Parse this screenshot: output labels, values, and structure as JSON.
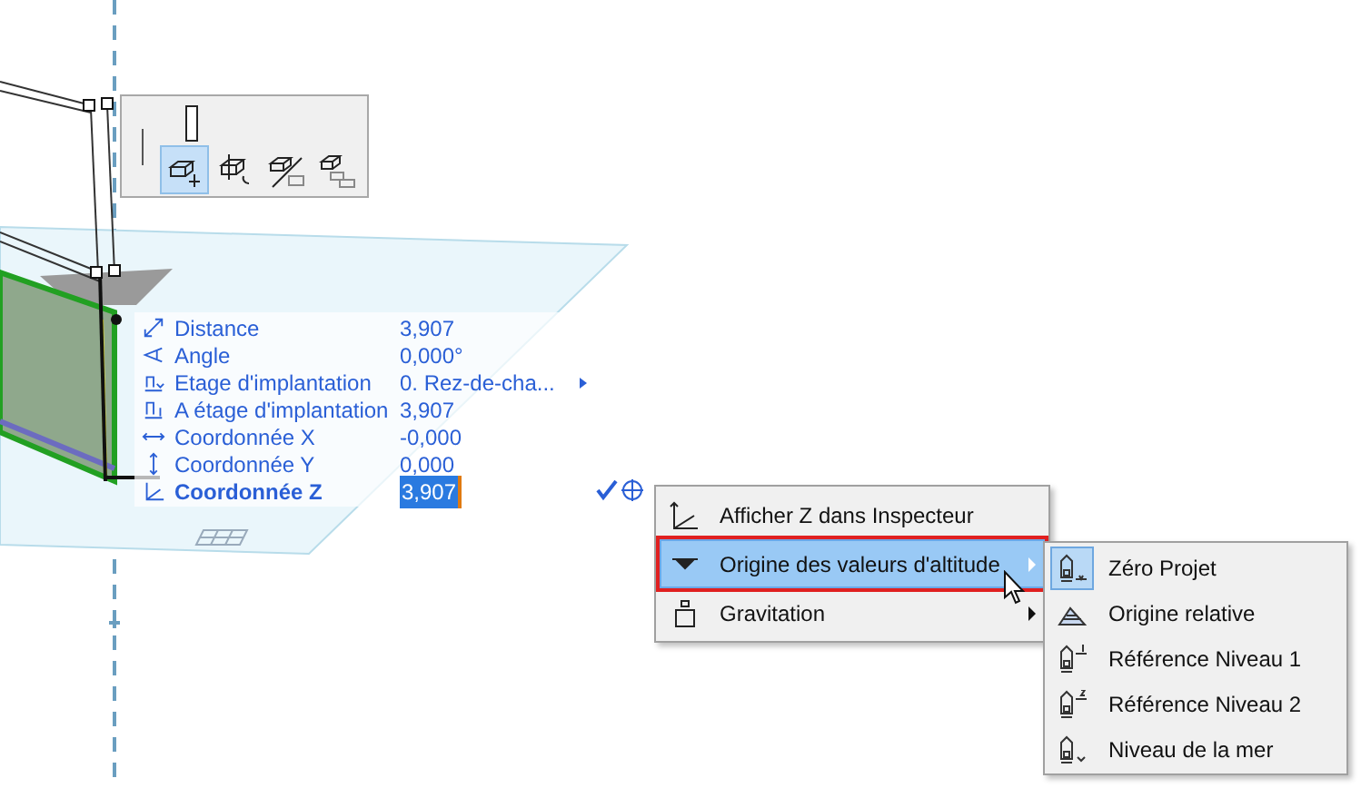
{
  "palette": {
    "tools": [
      {
        "selected": true
      },
      {
        "selected": false
      },
      {
        "selected": false
      },
      {
        "selected": false
      }
    ]
  },
  "tracker": {
    "rows": [
      {
        "label": "Distance",
        "value": "3,907",
        "submenu": false,
        "selected": false
      },
      {
        "label": "Angle",
        "value": "0,000°",
        "submenu": false,
        "selected": false
      },
      {
        "label": "Etage d'implantation",
        "value": "0. Rez-de-cha...",
        "submenu": true,
        "selected": false
      },
      {
        "label": "A étage d'implantation",
        "value": "3,907",
        "submenu": false,
        "selected": false
      },
      {
        "label": "Coordonnée X",
        "value": "-0,000",
        "submenu": false,
        "selected": false
      },
      {
        "label": "Coordonnée Y",
        "value": "0,000",
        "submenu": false,
        "selected": false
      },
      {
        "label": "Coordonnée Z",
        "value": "3,907",
        "submenu": false,
        "selected": true
      }
    ]
  },
  "context_menu": {
    "items": [
      {
        "label": "Afficher Z dans Inspecteur",
        "highlighted": false,
        "submenu": false
      },
      {
        "label": "Origine des valeurs d'altitude",
        "highlighted": true,
        "submenu": true
      },
      {
        "label": "Gravitation",
        "highlighted": false,
        "submenu": true
      }
    ]
  },
  "submenu": {
    "items": [
      {
        "label": "Zéro Projet",
        "selected": true
      },
      {
        "label": "Origine relative",
        "selected": false
      },
      {
        "label": "Référence Niveau 1",
        "selected": false
      },
      {
        "label": "Référence Niveau 2",
        "selected": false
      },
      {
        "label": "Niveau de la mer",
        "selected": false
      }
    ]
  }
}
